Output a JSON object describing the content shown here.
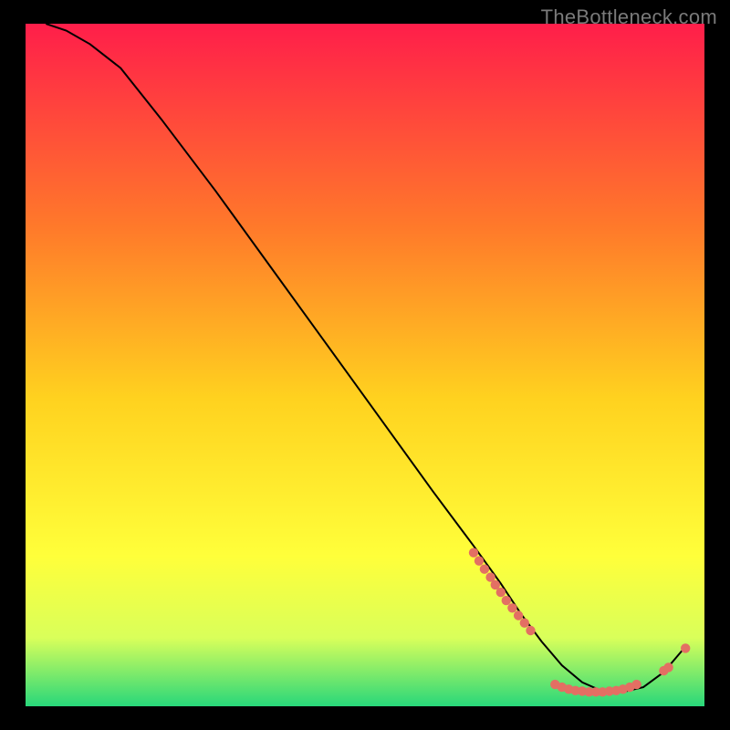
{
  "watermark": "TheBottleneck.com",
  "chart_data": {
    "type": "line",
    "title": "",
    "xlabel": "",
    "ylabel": "",
    "xlim": [
      0,
      100
    ],
    "ylim": [
      0,
      100
    ],
    "categories_estimated_note": "Axis labels and legend are not visible; x/y expressed as percentages of plot area. Curve shows a steep decline toward a flat minimum near the right side then a slight rise.",
    "series": [
      {
        "name": "curve",
        "type": "line",
        "color": "#000000",
        "x": [
          3,
          6,
          9.5,
          14,
          20,
          28,
          36,
          44,
          52,
          60,
          66,
          70,
          73,
          76,
          79,
          82,
          85,
          88,
          91,
          94,
          97
        ],
        "y": [
          100,
          99,
          97,
          93.5,
          86,
          75.5,
          64.5,
          53.5,
          42.5,
          31.5,
          23.5,
          18,
          13.5,
          9.5,
          6,
          3.5,
          2.2,
          2.1,
          2.8,
          5,
          8.5
        ]
      },
      {
        "name": "markers-left-cluster",
        "type": "scatter",
        "color": "#e36f63",
        "x": [
          66,
          66.8,
          67.6,
          68.5,
          69.2,
          70,
          70.8,
          71.7,
          72.6,
          73.5,
          74.4
        ],
        "y": [
          22.5,
          21.3,
          20.1,
          18.9,
          17.8,
          16.7,
          15.5,
          14.4,
          13.3,
          12.2,
          11.1
        ]
      },
      {
        "name": "markers-bottom-cluster",
        "type": "scatter",
        "color": "#e36f63",
        "x": [
          78,
          79,
          80,
          81,
          82,
          83,
          84,
          85,
          86,
          87,
          88,
          89,
          90
        ],
        "y": [
          3.2,
          2.8,
          2.5,
          2.3,
          2.2,
          2.1,
          2.1,
          2.1,
          2.2,
          2.3,
          2.5,
          2.8,
          3.2
        ]
      },
      {
        "name": "markers-right-cluster",
        "type": "scatter",
        "color": "#e36f63",
        "x": [
          94,
          94.7,
          97.2
        ],
        "y": [
          5.2,
          5.7,
          8.5
        ]
      }
    ],
    "background_gradient": {
      "top": "#ff1e4a",
      "upper_mid": "#ff7a2a",
      "mid": "#ffd21f",
      "lower_mid": "#ffff3a",
      "lower": "#d9ff5a",
      "bottom": "#28d77a"
    }
  }
}
